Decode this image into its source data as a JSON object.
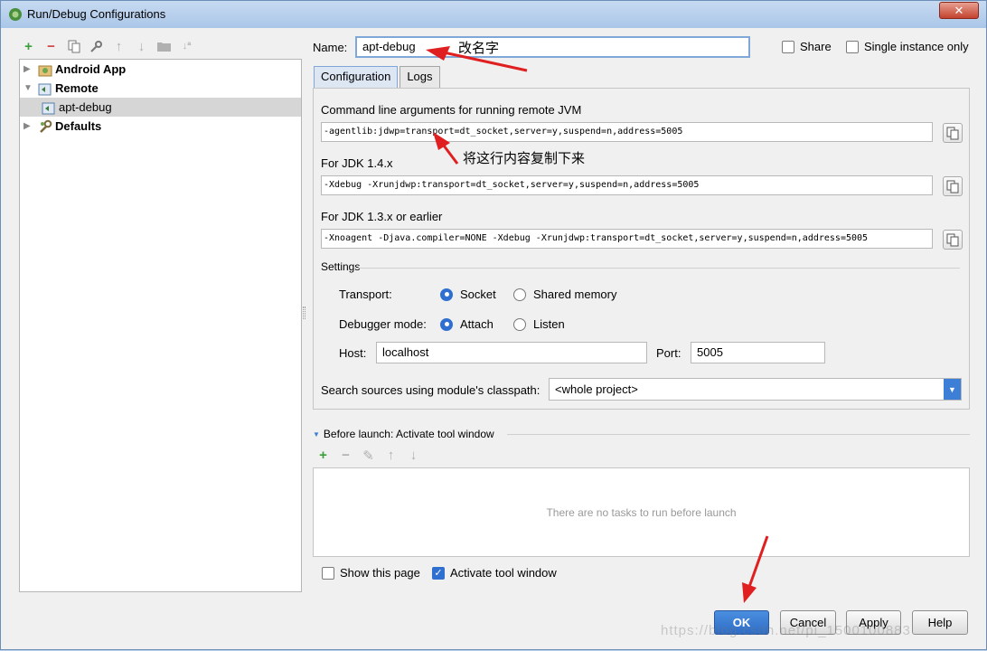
{
  "window": {
    "title": "Run/Debug Configurations",
    "close_label": "✕"
  },
  "tree": {
    "items": [
      {
        "label": "Android App",
        "icon": "android-app-icon",
        "bold": true,
        "expanded": false
      },
      {
        "label": "Remote",
        "icon": "remote-icon",
        "bold": true,
        "expanded": true
      },
      {
        "label": "apt-debug",
        "icon": "remote-config-icon",
        "bold": false,
        "selected": true
      },
      {
        "label": "Defaults",
        "icon": "wrench-icon",
        "bold": true,
        "expanded": false
      }
    ]
  },
  "header": {
    "name_label": "Name:",
    "name_value": "apt-debug",
    "share_label": "Share",
    "share_checked": false,
    "single_instance_label": "Single instance only",
    "single_instance_checked": false
  },
  "tabs": [
    {
      "label": "Configuration",
      "active": true
    },
    {
      "label": "Logs",
      "active": false
    }
  ],
  "config": {
    "cmd_label": "Command line arguments for running remote JVM",
    "cmd_value": "-agentlib:jdwp=transport=dt_socket,server=y,suspend=n,address=5005",
    "jdk14_label": "For JDK 1.4.x",
    "jdk14_value": "-Xdebug -Xrunjdwp:transport=dt_socket,server=y,suspend=n,address=5005",
    "jdk13_label": "For JDK 1.3.x or earlier",
    "jdk13_value": "-Xnoagent -Djava.compiler=NONE -Xdebug -Xrunjdwp:transport=dt_socket,server=y,suspend=n,address=5005",
    "settings_label": "Settings",
    "transport_label": "Transport:",
    "transport_socket": "Socket",
    "transport_shared": "Shared memory",
    "transport_selected": "Socket",
    "debugger_mode_label": "Debugger mode:",
    "mode_attach": "Attach",
    "mode_listen": "Listen",
    "mode_selected": "Attach",
    "host_label": "Host:",
    "host_value": "localhost",
    "port_label": "Port:",
    "port_value": "5005",
    "classpath_label": "Search sources using module's classpath:",
    "classpath_value": "<whole project>"
  },
  "before_launch": {
    "label": "Before launch: Activate tool window",
    "empty_text": "There are no tasks to run before launch",
    "show_page_label": "Show this page",
    "show_page_checked": false,
    "activate_label": "Activate tool window",
    "activate_checked": true
  },
  "buttons": {
    "ok": "OK",
    "cancel": "Cancel",
    "apply": "Apply",
    "help": "Help"
  },
  "annotations": {
    "rename": "改名字",
    "copy_line": "将这行内容复制下来"
  },
  "watermark": "https://blog.csdn.net/pi_1500100883",
  "colors": {
    "accent": "#2f6fcf",
    "arrow": "#e02020"
  }
}
